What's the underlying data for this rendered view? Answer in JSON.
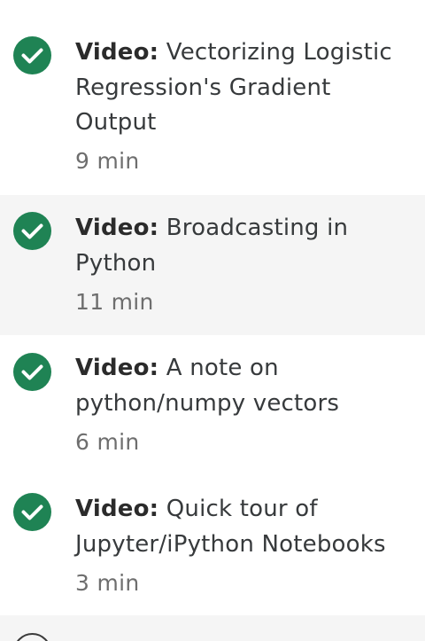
{
  "lessons": [
    {
      "kind_label": "Video:",
      "title": "Vectorizing Logistic Regression's Gradient Output",
      "duration": "9 min",
      "completed": true,
      "icon": "checkmark-circle-icon"
    },
    {
      "kind_label": "Video:",
      "title": "Broadcasting in Python",
      "duration": "11 min",
      "completed": true,
      "icon": "checkmark-circle-icon"
    },
    {
      "kind_label": "Video:",
      "title": "A note on python/numpy vectors",
      "duration": "6 min",
      "completed": true,
      "icon": "checkmark-circle-icon"
    },
    {
      "kind_label": "Video:",
      "title": "Quick tour of Jupyter/iPython Notebooks",
      "duration": "3 min",
      "completed": true,
      "icon": "checkmark-circle-icon"
    },
    {
      "completed": false,
      "icon": "empty-circle-icon"
    }
  ],
  "colors": {
    "completed_icon": "#1f8354",
    "alt_row_background": "#f5f5f5",
    "title_text": "#373a3c",
    "duration_text": "#6e6e6e"
  }
}
